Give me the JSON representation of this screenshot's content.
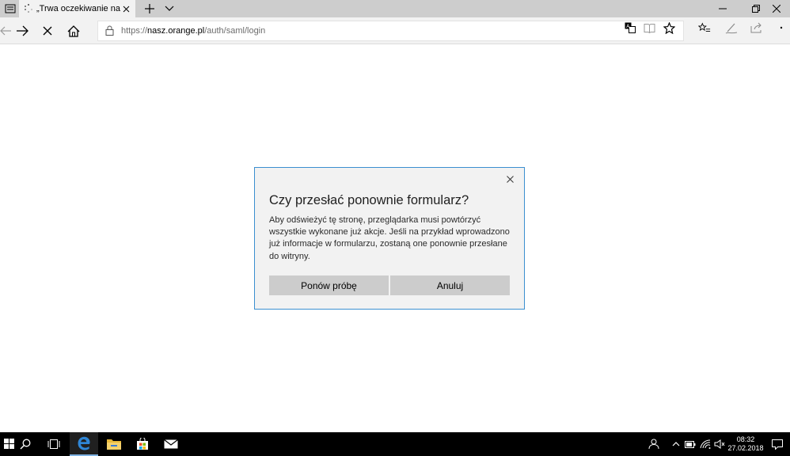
{
  "window": {
    "tab_title": "„Trwa oczekiwanie na odpowiedź",
    "controls": {
      "minimize_icon": "minimize-icon",
      "restore_icon": "restore-icon",
      "close_icon": "close-icon"
    }
  },
  "address_bar": {
    "url_prefix": "https://",
    "url_host": "nasz.orange.pl",
    "url_path": "/auth/saml/login"
  },
  "dialog": {
    "title": "Czy przesłać ponownie formularz?",
    "body": "Aby odświeżyć tę stronę, przeglądarka musi powtórzyć wszystkie wykonane już akcje. Jeśli na przykład wprowadzono już informacje w formularzu, zostaną one ponownie przesłane do witryny.",
    "retry_label": "Ponów próbę",
    "cancel_label": "Anuluj"
  },
  "taskbar": {
    "time": "08:32",
    "date": "27.02.2018"
  },
  "colors": {
    "tab_bar": "#cdcdcd",
    "toolbar": "#f2f2f2",
    "dialog_border": "#3b8fd0",
    "dialog_button": "#cccccc",
    "taskbar": "#000000",
    "edge_blue": "#2f86d6"
  }
}
